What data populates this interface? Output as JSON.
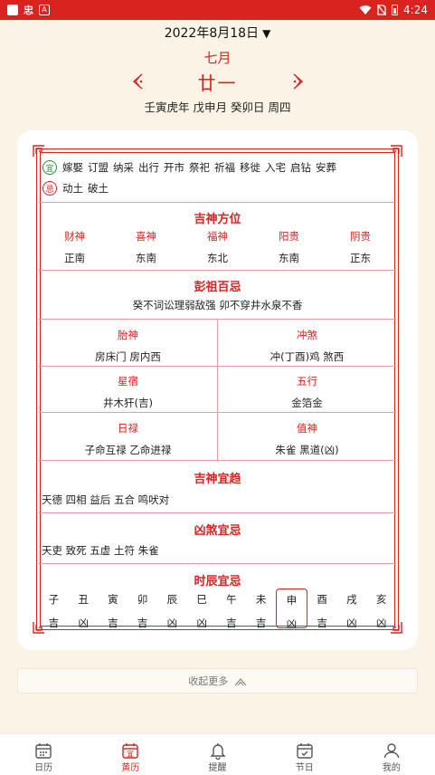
{
  "status_bar": {
    "time": "4:24",
    "app_icon_text": "忠",
    "a_icon_text": "A"
  },
  "header": {
    "solar_date": "2022年8月18日",
    "lunar_month": "七月",
    "lunar_day": "廿一",
    "ganzhi": "壬寅虎年 戊申月 癸卯日 周四"
  },
  "yi": {
    "badge": "宜",
    "items": [
      "嫁娶",
      "订盟",
      "纳采",
      "出行",
      "开市",
      "祭祀",
      "祈福",
      "移徙",
      "入宅",
      "启钻",
      "安葬"
    ]
  },
  "ji": {
    "badge": "忌",
    "items": [
      "动土",
      "破土"
    ]
  },
  "gods_direction": {
    "title": "吉神方位",
    "cols": [
      {
        "label": "财神",
        "value": "正南"
      },
      {
        "label": "喜神",
        "value": "东南"
      },
      {
        "label": "福神",
        "value": "东北"
      },
      {
        "label": "阳贵",
        "value": "东南"
      },
      {
        "label": "阴贵",
        "value": "正东"
      }
    ]
  },
  "pengzu": {
    "title": "彭祖百忌",
    "text": "癸不词讼理弱敌强 卯不穿井水泉不香"
  },
  "grid": {
    "taishen": {
      "label": "胎神",
      "value": "房床门 房内西"
    },
    "chongsha": {
      "label": "冲煞",
      "value": "冲(丁酉)鸡 煞西"
    },
    "xingxiu": {
      "label": "星宿",
      "value": "井木犴(吉)"
    },
    "wuxing": {
      "label": "五行",
      "value": "金箔金"
    },
    "rilu": {
      "label": "日禄",
      "value": "子命互禄 乙命进禄"
    },
    "zhishen": {
      "label": "值神",
      "value": "朱雀 黑道(凶)"
    }
  },
  "jishen": {
    "title": "吉神宜趋",
    "text": "天德 四相 益后 五合 鸣吠对"
  },
  "xiongsha": {
    "title": "凶煞宜忌",
    "text": "天吏 致死 五虚 土符 朱雀"
  },
  "hours": {
    "title": "时辰宜忌",
    "items": [
      {
        "branch": "子",
        "luck": "吉"
      },
      {
        "branch": "丑",
        "luck": "凶"
      },
      {
        "branch": "寅",
        "luck": "吉"
      },
      {
        "branch": "卯",
        "luck": "吉"
      },
      {
        "branch": "辰",
        "luck": "凶"
      },
      {
        "branch": "巳",
        "luck": "凶"
      },
      {
        "branch": "午",
        "luck": "吉"
      },
      {
        "branch": "未",
        "luck": "吉"
      },
      {
        "branch": "申",
        "luck": "凶"
      },
      {
        "branch": "酉",
        "luck": "吉"
      },
      {
        "branch": "戌",
        "luck": "凶"
      },
      {
        "branch": "亥",
        "luck": "凶"
      }
    ],
    "active_index": 8
  },
  "collapse": {
    "label": "收起更多"
  },
  "nav": [
    {
      "label": "日历",
      "icon": "calendar-icon"
    },
    {
      "label": "黄历",
      "icon": "almanac-icon"
    },
    {
      "label": "提醒",
      "icon": "bell-icon"
    },
    {
      "label": "节日",
      "icon": "festival-icon"
    },
    {
      "label": "我的",
      "icon": "user-icon"
    }
  ],
  "colors": {
    "accent": "#d9231f",
    "background": "#fbf4e6",
    "yi_green": "#2e8b3b"
  }
}
